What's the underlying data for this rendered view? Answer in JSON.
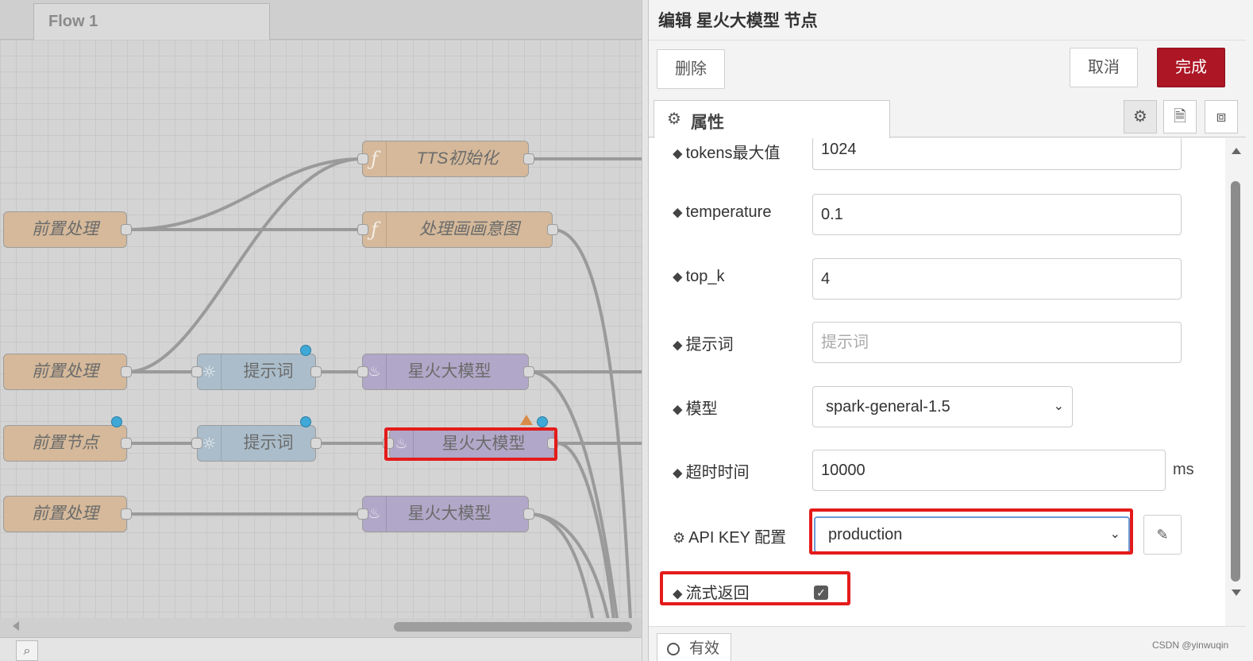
{
  "workspace": {
    "flow_tab": "Flow 1",
    "nodes": {
      "tts_init": "TTS初始化",
      "pre1": "前置处理",
      "draw_intent": "处理画画意图",
      "pre2": "前置处理",
      "prompt1": "提示词",
      "spark1": "星火大模型",
      "pre_node": "前置节点",
      "prompt2": "提示词",
      "spark2": "星火大模型",
      "pre3": "前置处理",
      "spark3": "星火大模型"
    },
    "icons": {
      "function": "function-icon",
      "prompt": "lightbulb-icon",
      "spark": "flame-icon",
      "search": "search-icon"
    },
    "colors": {
      "function_node": "#d5b99a",
      "prompt_node": "#abbdca",
      "spark_node": "#b1a7c8",
      "highlight": "#e41b1b",
      "changed_dot": "#3fa8d6"
    }
  },
  "tray": {
    "title": "编辑 星火大模型 节点",
    "delete_label": "删除",
    "cancel_label": "取消",
    "done_label": "完成",
    "tab_properties": "属性",
    "tab_icons": [
      "gear-icon",
      "document-icon",
      "appearance-icon"
    ],
    "fields": {
      "tokens_label": "tokens最大值",
      "tokens_value": "1024",
      "temperature_label": "temperature",
      "temperature_value": "0.1",
      "topk_label": "top_k",
      "topk_value": "4",
      "prompt_label": "提示词",
      "prompt_placeholder": "提示词",
      "model_label": "模型",
      "model_value": "spark-general-1.5",
      "timeout_label": "超时时间",
      "timeout_value": "10000",
      "timeout_unit": "ms",
      "apikey_label": "API KEY 配置",
      "apikey_value": "production",
      "stream_label": "流式返回",
      "stream_checked": true
    },
    "valid_label": "有效",
    "watermark": "CSDN @yinwuqin",
    "colors": {
      "done_button": "#ad1625"
    }
  }
}
